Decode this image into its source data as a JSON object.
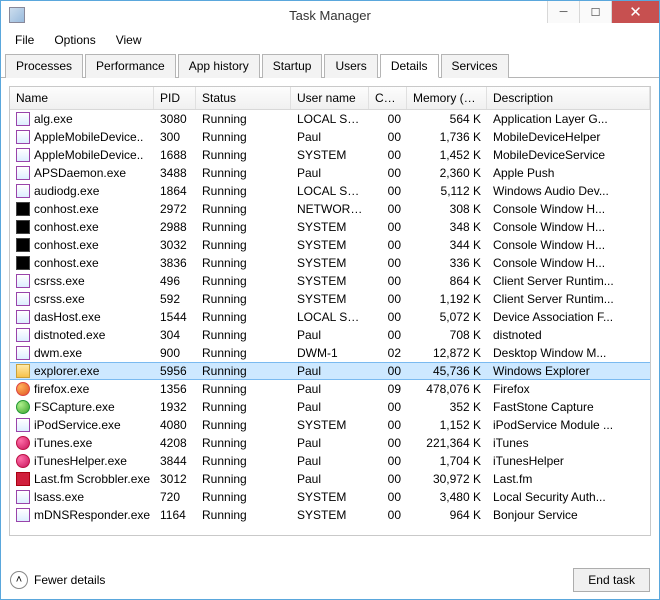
{
  "window": {
    "title": "Task Manager"
  },
  "menu": {
    "file": "File",
    "options": "Options",
    "view": "View"
  },
  "tabs": [
    {
      "label": "Processes"
    },
    {
      "label": "Performance"
    },
    {
      "label": "App history"
    },
    {
      "label": "Startup"
    },
    {
      "label": "Users"
    },
    {
      "label": "Details",
      "active": true
    },
    {
      "label": "Services"
    }
  ],
  "columns": {
    "name": "Name",
    "pid": "PID",
    "status": "Status",
    "user": "User name",
    "cpu": "CPU",
    "mem": "Memory (p...",
    "desc": "Description"
  },
  "rows": [
    {
      "name": "alg.exe",
      "pid": "3080",
      "status": "Running",
      "user": "LOCAL SE...",
      "cpu": "00",
      "mem": "564 K",
      "desc": "Application Layer G...",
      "icon": ""
    },
    {
      "name": "AppleMobileDevice..",
      "pid": "300",
      "status": "Running",
      "user": "Paul",
      "cpu": "00",
      "mem": "1,736 K",
      "desc": "MobileDeviceHelper",
      "icon": ""
    },
    {
      "name": "AppleMobileDevice..",
      "pid": "1688",
      "status": "Running",
      "user": "SYSTEM",
      "cpu": "00",
      "mem": "1,452 K",
      "desc": "MobileDeviceService",
      "icon": ""
    },
    {
      "name": "APSDaemon.exe",
      "pid": "3488",
      "status": "Running",
      "user": "Paul",
      "cpu": "00",
      "mem": "2,360 K",
      "desc": "Apple Push",
      "icon": ""
    },
    {
      "name": "audiodg.exe",
      "pid": "1864",
      "status": "Running",
      "user": "LOCAL SE...",
      "cpu": "00",
      "mem": "5,112 K",
      "desc": "Windows Audio Dev...",
      "icon": ""
    },
    {
      "name": "conhost.exe",
      "pid": "2972",
      "status": "Running",
      "user": "NETWORK...",
      "cpu": "00",
      "mem": "308 K",
      "desc": "Console Window H...",
      "icon": "con"
    },
    {
      "name": "conhost.exe",
      "pid": "2988",
      "status": "Running",
      "user": "SYSTEM",
      "cpu": "00",
      "mem": "348 K",
      "desc": "Console Window H...",
      "icon": "con"
    },
    {
      "name": "conhost.exe",
      "pid": "3032",
      "status": "Running",
      "user": "SYSTEM",
      "cpu": "00",
      "mem": "344 K",
      "desc": "Console Window H...",
      "icon": "con"
    },
    {
      "name": "conhost.exe",
      "pid": "3836",
      "status": "Running",
      "user": "SYSTEM",
      "cpu": "00",
      "mem": "336 K",
      "desc": "Console Window H...",
      "icon": "con"
    },
    {
      "name": "csrss.exe",
      "pid": "496",
      "status": "Running",
      "user": "SYSTEM",
      "cpu": "00",
      "mem": "864 K",
      "desc": "Client Server Runtim...",
      "icon": ""
    },
    {
      "name": "csrss.exe",
      "pid": "592",
      "status": "Running",
      "user": "SYSTEM",
      "cpu": "00",
      "mem": "1,192 K",
      "desc": "Client Server Runtim...",
      "icon": ""
    },
    {
      "name": "dasHost.exe",
      "pid": "1544",
      "status": "Running",
      "user": "LOCAL SE...",
      "cpu": "00",
      "mem": "5,072 K",
      "desc": "Device Association F...",
      "icon": ""
    },
    {
      "name": "distnoted.exe",
      "pid": "304",
      "status": "Running",
      "user": "Paul",
      "cpu": "00",
      "mem": "708 K",
      "desc": "distnoted",
      "icon": ""
    },
    {
      "name": "dwm.exe",
      "pid": "900",
      "status": "Running",
      "user": "DWM-1",
      "cpu": "02",
      "mem": "12,872 K",
      "desc": "Desktop Window M...",
      "icon": ""
    },
    {
      "name": "explorer.exe",
      "pid": "5956",
      "status": "Running",
      "user": "Paul",
      "cpu": "00",
      "mem": "45,736 K",
      "desc": "Windows Explorer",
      "icon": "explorer",
      "selected": true
    },
    {
      "name": "firefox.exe",
      "pid": "1356",
      "status": "Running",
      "user": "Paul",
      "cpu": "09",
      "mem": "478,076 K",
      "desc": "Firefox",
      "icon": "ff"
    },
    {
      "name": "FSCapture.exe",
      "pid": "1932",
      "status": "Running",
      "user": "Paul",
      "cpu": "00",
      "mem": "352 K",
      "desc": "FastStone Capture",
      "icon": "fs"
    },
    {
      "name": "iPodService.exe",
      "pid": "4080",
      "status": "Running",
      "user": "SYSTEM",
      "cpu": "00",
      "mem": "1,152 K",
      "desc": "iPodService Module ...",
      "icon": ""
    },
    {
      "name": "iTunes.exe",
      "pid": "4208",
      "status": "Running",
      "user": "Paul",
      "cpu": "00",
      "mem": "221,364 K",
      "desc": "iTunes",
      "icon": "itunes"
    },
    {
      "name": "iTunesHelper.exe",
      "pid": "3844",
      "status": "Running",
      "user": "Paul",
      "cpu": "00",
      "mem": "1,704 K",
      "desc": "iTunesHelper",
      "icon": "itunes"
    },
    {
      "name": "Last.fm Scrobbler.exe",
      "pid": "3012",
      "status": "Running",
      "user": "Paul",
      "cpu": "00",
      "mem": "30,972 K",
      "desc": "Last.fm",
      "icon": "lfm"
    },
    {
      "name": "lsass.exe",
      "pid": "720",
      "status": "Running",
      "user": "SYSTEM",
      "cpu": "00",
      "mem": "3,480 K",
      "desc": "Local Security Auth...",
      "icon": ""
    },
    {
      "name": "mDNSResponder.exe",
      "pid": "1164",
      "status": "Running",
      "user": "SYSTEM",
      "cpu": "00",
      "mem": "964 K",
      "desc": "Bonjour Service",
      "icon": ""
    }
  ],
  "footer": {
    "fewer": "Fewer details",
    "end": "End task"
  }
}
